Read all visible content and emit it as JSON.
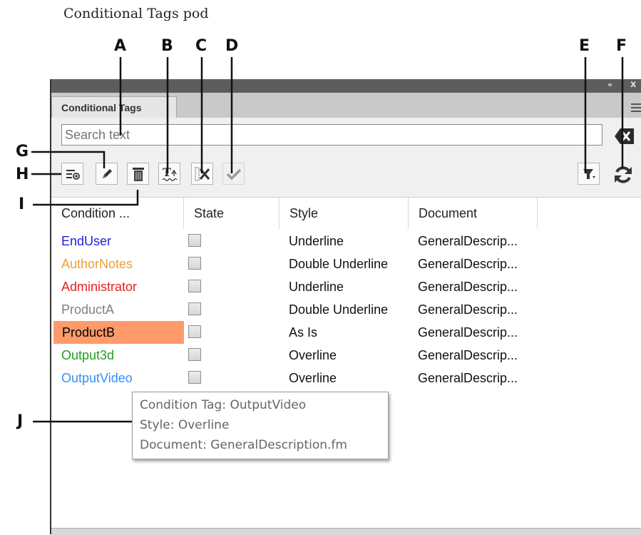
{
  "caption": "Conditional Tags pod",
  "callouts": [
    "A",
    "B",
    "C",
    "D",
    "E",
    "F",
    "G",
    "H",
    "I",
    "J"
  ],
  "panel": {
    "title_controls": {
      "collapse": "«",
      "close": "x"
    },
    "tab_label": "Conditional Tags",
    "menu_icon": "panel-menu-icon"
  },
  "search": {
    "placeholder": "Search text",
    "value": ""
  },
  "toolbar": {
    "buttons": [
      {
        "name": "new-tag-icon",
        "enabled": true
      },
      {
        "name": "edit-pencil-icon",
        "enabled": true
      },
      {
        "name": "delete-trash-icon",
        "enabled": true
      },
      {
        "name": "apply-style-icon",
        "enabled": true
      },
      {
        "name": "remove-tag-icon",
        "enabled": true
      },
      {
        "name": "apply-check-icon",
        "enabled": false
      },
      {
        "name": "filter-icon",
        "enabled": true
      },
      {
        "name": "refresh-icon",
        "enabled": true
      }
    ]
  },
  "table": {
    "headers": [
      "Condition ...",
      "State",
      "Style",
      "Document"
    ],
    "rows": [
      {
        "condition": "EndUser",
        "color": "#2020e0",
        "style": "Underline",
        "document": "GeneralDescrip...",
        "selected": false
      },
      {
        "condition": "AuthorNotes",
        "color": "#f0a030",
        "style": "Double Underline",
        "document": "GeneralDescrip...",
        "selected": false
      },
      {
        "condition": "Administrator",
        "color": "#e82020",
        "style": "Underline",
        "document": "GeneralDescrip...",
        "selected": false
      },
      {
        "condition": "ProductA",
        "color": "#808080",
        "style": "Double Underline",
        "document": "GeneralDescrip...",
        "selected": false
      },
      {
        "condition": "ProductB",
        "color": "#000000",
        "style": "As Is",
        "document": "GeneralDescrip...",
        "selected": true
      },
      {
        "condition": "Output3d",
        "color": "#20a020",
        "style": "Overline",
        "document": "GeneralDescrip...",
        "selected": false
      },
      {
        "condition": "OutputVideo",
        "color": "#3090ff",
        "style": "Overline",
        "document": "GeneralDescrip...",
        "selected": false
      }
    ],
    "selection_color": "#ff9a6a"
  },
  "tooltip": {
    "line1": "Condition Tag: OutputVideo",
    "line2": "Style: Overline",
    "line3": "Document: GeneralDescription.fm"
  }
}
